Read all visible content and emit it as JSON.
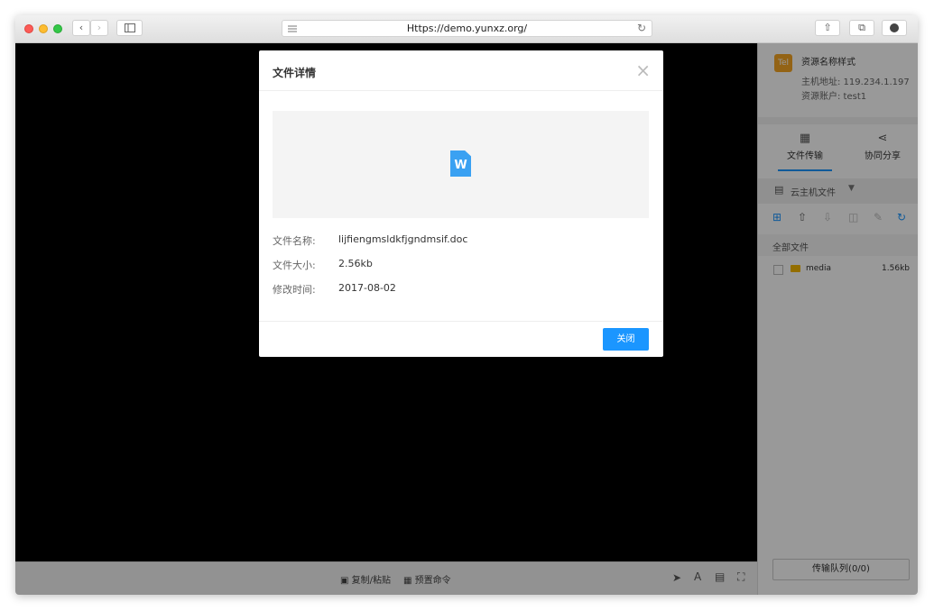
{
  "browser": {
    "url": "Https://demo.yunxz.org/"
  },
  "resource": {
    "badge": "Tel",
    "name": "资源名称样式",
    "host": "主机地址: 119.234.1.197",
    "account": "资源账户: test1"
  },
  "panel_tabs": [
    {
      "label": "文件传输",
      "active": true
    },
    {
      "label": "协同分享",
      "active": false
    }
  ],
  "file_source": "云主机文件",
  "all_files_label": "全部文件",
  "files": [
    {
      "name": "media",
      "size": "1.56kb"
    }
  ],
  "transfer_queue": "传输队列(0/0)",
  "bottom_bar": {
    "copy_paste": "复制/粘贴",
    "preset_cmd": "预置命令"
  },
  "dialog": {
    "title": "文件详情",
    "file_type_letter": "W",
    "name_label": "文件名称:",
    "name_value": "lijfiengmsldkfjgndmsif.doc",
    "size_label": "文件大小:",
    "size_value": "2.56kb",
    "time_label": "修改时间:",
    "time_value": "2017-08-02",
    "close_button": "关闭"
  },
  "colors": {
    "accent": "#1b96ff",
    "badge": "#f5a623",
    "folder": "#f5b800"
  }
}
